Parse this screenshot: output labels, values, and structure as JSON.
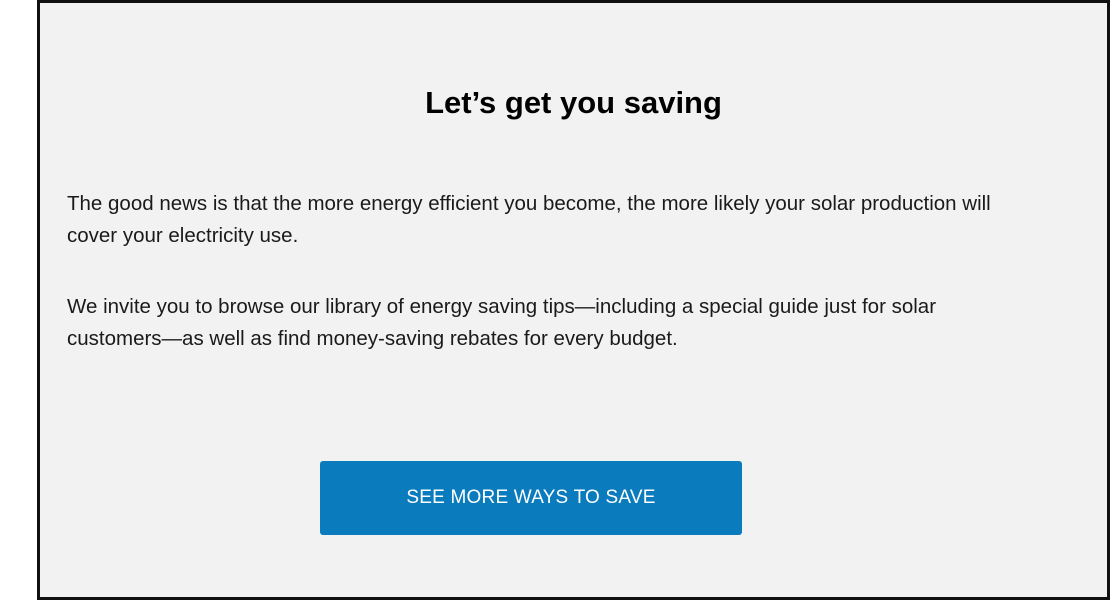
{
  "content": {
    "title": "Let’s get you saving",
    "paragraph1": "The good news is that the more energy efficient you become, the more likely your solar production will cover your electricity use.",
    "paragraph2": "We invite you to browse our library of energy saving tips—including a special guide just for solar customers—as well as find money-saving rebates for every budget.",
    "cta_label": "SEE MORE WAYS TO SAVE"
  },
  "colors": {
    "background": "#f2f2f2",
    "border": "#111111",
    "button": "#0a7bbd",
    "button_text": "#ffffff"
  }
}
